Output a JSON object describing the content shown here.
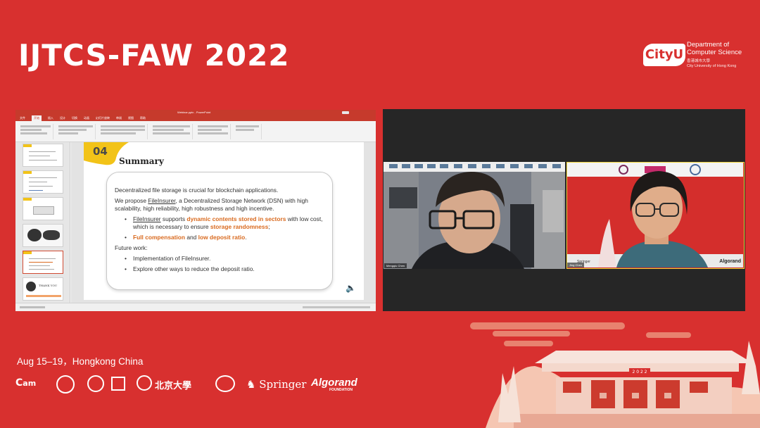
{
  "conference": {
    "title": "IJTCS-FAW 2022",
    "date_location": "Aug 15–19，Hongkong China"
  },
  "cityu": {
    "logo_text": "CityU",
    "department": "Department of Computer Science",
    "chinese_name": "香港城市大學",
    "english_name": "City University of Hong Kong"
  },
  "ppt": {
    "menu": [
      "文件",
      "开始",
      "插入",
      "设计",
      "切换",
      "动画",
      "幻灯片放映",
      "审阅",
      "视图",
      "帮助"
    ],
    "active_tab": "开始",
    "thumbnail_labels": [
      "",
      "",
      "",
      "",
      "",
      "THANK YOU"
    ],
    "slide": {
      "number": "04",
      "title": "Summary",
      "line1": "Decentralized file storage is crucial for blockchain applications.",
      "line2_prefix": "We propose ",
      "line2_name": "FileInsurer",
      "line2_suffix": ", a Decentralized Storage Network (DSN) with high scalability, high reliability, high robustness and high incentive.",
      "b1_name": "FileInsurer",
      "b1_text1": " supports ",
      "b1_highlight1": "dynamic contents stored in sectors",
      "b1_text2": " with low cost, which is necessary to ensure ",
      "b1_highlight2": "storage randomness",
      "b1_text3": ";",
      "b2_highlight1": "Full compensation",
      "b2_text": " and ",
      "b2_highlight2": "low deposit ratio",
      "b2_text2": ".",
      "future_work": "Future work:",
      "fw1": "Implementation of FileInsurer.",
      "fw2": "Explore other ways to reduce the deposit ratio."
    }
  },
  "video": {
    "left_name": "Mengqiu Chen",
    "right_name": "Jing Chen",
    "right_sponsor": "Springer",
    "right_sponsor2": "Algorand"
  },
  "sponsors": {
    "springer": "Springer",
    "algorand": "Algorand",
    "algorand_sub": "FOUNDATION",
    "pku": "北京大學"
  },
  "colors": {
    "background": "#d8302f",
    "accent_yellow": "#f2c318",
    "highlight_orange": "#d96a1f"
  }
}
